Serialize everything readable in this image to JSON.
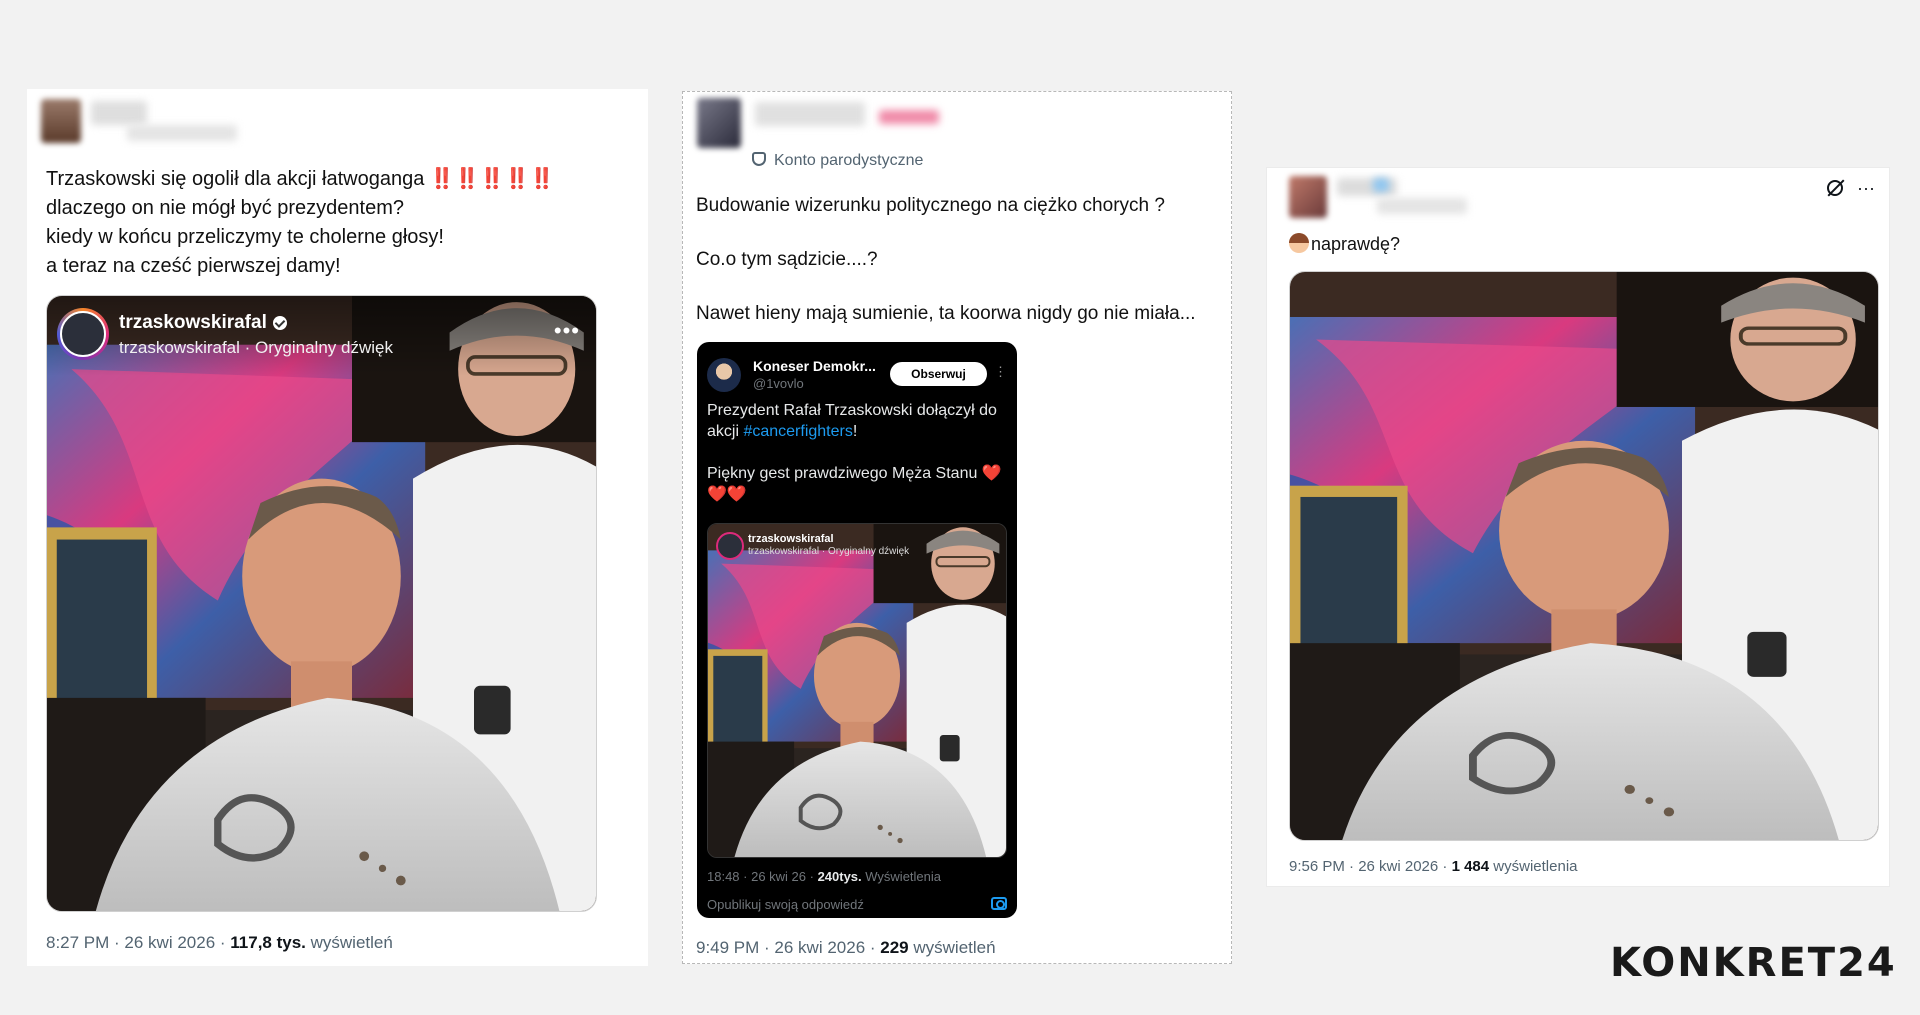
{
  "post1": {
    "text": "Trzaskowski się ogolił dla akcji łatwoganga ‼️‼️‼️‼️‼️\ndlaczego on nie mógł być prezydentem?\nkiedy w końcu przeliczymy te cholerne głosy!\na teraz na cześć pierwszej damy!",
    "ig_username": "trzaskowskirafal",
    "ig_sub": "trzaskowskirafal · Oryginalny dźwięk",
    "time_date": "8:27 PM · 26 kwi 2026 · ",
    "views_count": "117,8 tys.",
    "views_label": " wyświetleń"
  },
  "post2": {
    "parody_label": "Konto parodystyczne",
    "text": "Budowanie wizerunku politycznego na ciężko chorych ?\n\nCo.o tym sądzicie....?\n\nNawet hieny mają sumienie, ta koorwa nigdy go nie miała...",
    "embed": {
      "name": "Koneser Demokr...",
      "handle": "@1vovlo",
      "follow_label": "Obserwuj",
      "text_before_tag": "Prezydent Rafał Trzaskowski dołączył do akcji ",
      "hashtag": "#cancerfighters",
      "text_after_tag": "!\n\nPiękny gest prawdziwego Męża Stanu ❤️\n❤️❤️",
      "mini_user": "trzaskowskirafal",
      "mini_sub": "trzaskowskirafal · Oryginalny dźwięk",
      "meta_time": "18:48 · 26 kwi 26 · ",
      "meta_views": "240tys.",
      "meta_views_label": " Wyświetlenia",
      "reply_placeholder": "Opublikuj swoją odpowiedź"
    },
    "time_date": "9:49 PM · 26 kwi 2026 · ",
    "views_count": "229",
    "views_label": " wyświetleń"
  },
  "post3": {
    "text": "naprawdę?",
    "time_date": "9:56 PM · 26 kwi 2026 · ",
    "views_count": "1 484",
    "views_label": " wyświetlenia",
    "more_label": "···"
  },
  "logo": {
    "text_main": "KONKRET",
    "text_num": "24"
  },
  "icons": [
    "verified-icon",
    "more-icon",
    "parody-mask-icon",
    "grok-icon",
    "camera-icon",
    "emoji-face-icon"
  ],
  "colors": {
    "link": "#1d9bf0",
    "muted": "#536471",
    "text": "#0f1419"
  }
}
